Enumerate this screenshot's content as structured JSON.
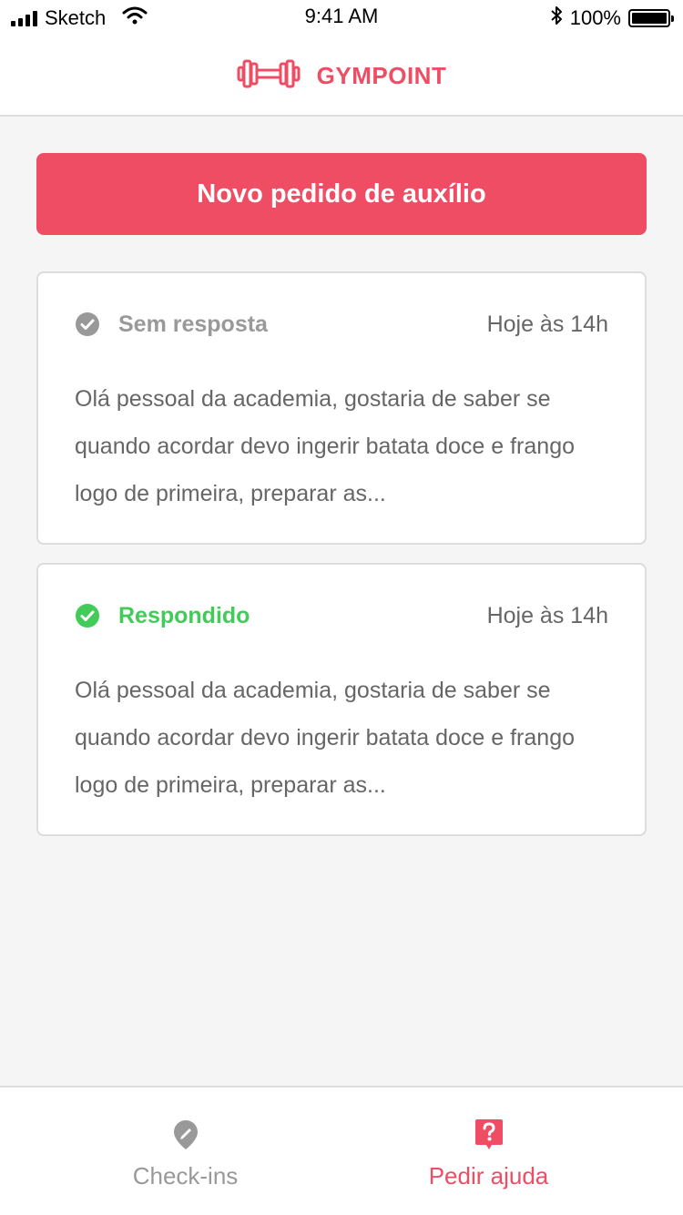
{
  "status_bar": {
    "carrier": "Sketch",
    "time": "9:41 AM",
    "battery_percent": "100%",
    "signal_icon": "signal-bars-icon",
    "wifi_icon": "wifi-icon",
    "bluetooth_icon": "bluetooth-icon",
    "battery_icon": "battery-icon"
  },
  "header": {
    "logo_icon": "dumbbell-icon",
    "brand": "GYMPOINT",
    "brand_color": "#ee4d64"
  },
  "main": {
    "new_request_label": "Novo pedido de auxílio",
    "requests": [
      {
        "status": "Sem resposta",
        "status_icon": "check-circle-icon",
        "status_color": "#999999",
        "date": "Hoje às 14h",
        "body": "Olá pessoal da academia, gostaria de saber se quando acordar devo ingerir batata doce e frango logo de primeira, preparar as..."
      },
      {
        "status": "Respondido",
        "status_icon": "check-circle-icon",
        "status_color": "#42cb59",
        "date": "Hoje às 14h",
        "body": "Olá pessoal da academia, gostaria de saber se quando acordar devo ingerir batata doce e frango logo de primeira, preparar as..."
      }
    ]
  },
  "tab_bar": {
    "tabs": [
      {
        "label": "Check-ins",
        "icon": "location-pin-icon",
        "active": false
      },
      {
        "label": "Pedir ajuda",
        "icon": "question-bubble-icon",
        "active": true
      }
    ],
    "active_color": "#ee4d64",
    "inactive_color": "#999999"
  }
}
